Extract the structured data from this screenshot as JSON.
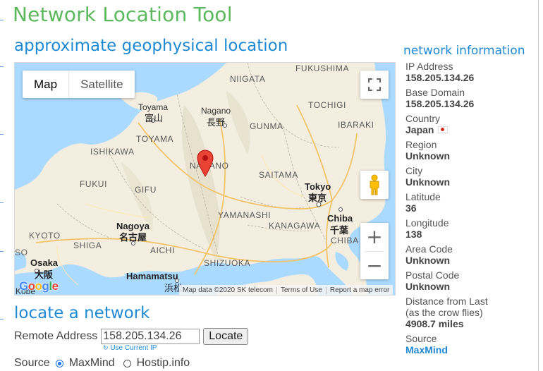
{
  "page": {
    "title": "Network Location Tool"
  },
  "geo_section": {
    "heading": "approximate geophysical location",
    "map": {
      "type_buttons": [
        "Map",
        "Satellite"
      ],
      "active_type": "Map",
      "labels": {
        "regions": [
          "NIIGATA",
          "FUKUSHIMA",
          "TOCHIGI",
          "GUNMA",
          "IBARAKI",
          "TOYAMA",
          "ISHIKAWA",
          "NAGANO",
          "SAITAMA",
          "FUKUI",
          "GIFU",
          "YAMANASHI",
          "KANAGAWA",
          "KYOTO",
          "SHIGA",
          "AICHI",
          "SHIZUOKA",
          "CHIBA"
        ],
        "cities": {
          "toyama": "Toyama",
          "toyama_kanji": "富山",
          "nagano": "Nagano",
          "nagano_kanji": "長野",
          "tokyo": "Tokyo",
          "tokyo_kanji": "東京",
          "chiba": "Chiba",
          "chiba_kanji": "千葉",
          "nagoya": "Nagoya",
          "nagoya_kanji": "名古屋",
          "osaka": "Osaka",
          "osaka_kanji": "大阪",
          "hamamatsu": "Hamamatsu",
          "hamamatsu_kanji": "浜松",
          "kobe": "Kobe",
          "so": "SO"
        }
      },
      "google_logo": "Google",
      "attribution": [
        "Map data ©2020 SK telecom",
        "Terms of Use",
        "Report a map error"
      ],
      "zoom_in": "+",
      "zoom_out": "−"
    }
  },
  "locate_section": {
    "heading": "locate a network",
    "remote_address_label": "Remote Address",
    "remote_address_value": "158.205.134.26",
    "locate_button": "Locate",
    "use_current_ip": "Use Current IP",
    "source_label": "Source",
    "source_options": [
      "MaxMind",
      "Hostip.info"
    ],
    "source_selected": "MaxMind"
  },
  "network_info": {
    "heading": "network information",
    "fields": [
      {
        "label": "IP Address",
        "value": "158.205.134.26"
      },
      {
        "label": "Base Domain",
        "value": "158.205.134.26"
      },
      {
        "label": "Country",
        "value": "Japan"
      },
      {
        "label": "Region",
        "value": "Unknown"
      },
      {
        "label": "City",
        "value": "Unknown"
      },
      {
        "label": "Latitude",
        "value": "36"
      },
      {
        "label": "Longitude",
        "value": "138"
      },
      {
        "label": "Area Code",
        "value": "Unknown"
      },
      {
        "label": "Postal Code",
        "value": "Unknown"
      },
      {
        "label": "Distance from Last (as the crow flies)",
        "value": "4908.7 miles"
      },
      {
        "label": "Source",
        "value": "MaxMind"
      }
    ]
  },
  "colors": {
    "title": "#5cb85c",
    "heading": "#1f8ad4",
    "water": "#aadaff",
    "land": "#f3eedf",
    "marker": "#ea4335"
  }
}
